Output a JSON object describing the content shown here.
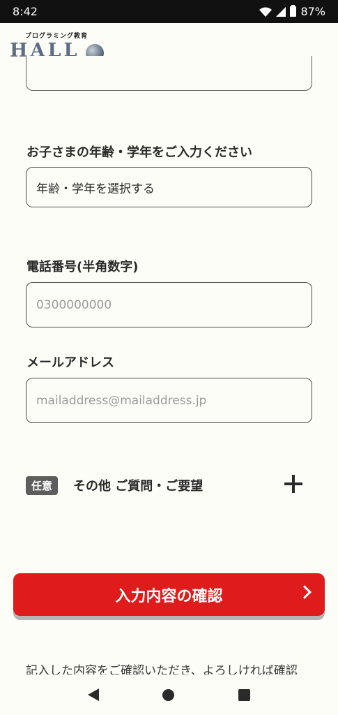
{
  "status_bar": {
    "time": "8:42",
    "battery": "87%"
  },
  "header": {
    "logo_subtitle": "プログラミング教育",
    "logo_text": "HALL"
  },
  "form": {
    "child_age": {
      "label": "お子さまの年齢・学年をご入力ください",
      "value": "年齢・学年を選択する"
    },
    "phone": {
      "label": "電話番号(半角数字)",
      "placeholder": "0300000000"
    },
    "email": {
      "label": "メールアドレス",
      "placeholder": "mailaddress@mailaddress.jp"
    },
    "other": {
      "badge": "任意",
      "label": "その他 ご質問・ご要望"
    }
  },
  "confirm_button": {
    "label": "入力内容の確認"
  },
  "note": "記入した内容をご確認いただき、よろしければ確認"
}
